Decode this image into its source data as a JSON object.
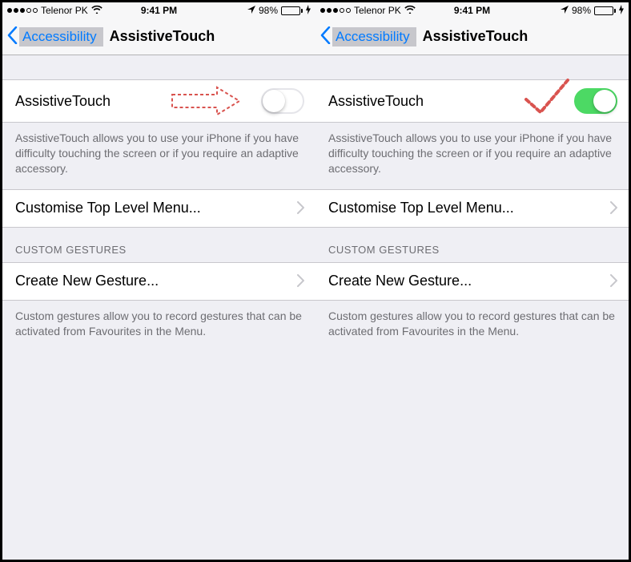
{
  "status_bar": {
    "carrier": "Telenor PK",
    "time": "9:41 PM",
    "battery_pct": "98%",
    "signal_filled": 3,
    "signal_total": 5
  },
  "nav": {
    "back_label": "Accessibility",
    "title": "AssistiveTouch"
  },
  "rows": {
    "toggle_label": "AssistiveTouch",
    "toggle_footer": "AssistiveTouch allows you to use your iPhone if you have difficulty touching the screen or if you require an adaptive accessory.",
    "customise_label": "Customise Top Level Menu...",
    "gestures_header": "CUSTOM GESTURES",
    "create_gesture_label": "Create New Gesture...",
    "gestures_footer": "Custom gestures allow you to record gestures that can be activated from Favourites in the Menu."
  },
  "panes": [
    {
      "toggle_on": false
    },
    {
      "toggle_on": true
    }
  ],
  "colors": {
    "accent": "#007aff",
    "switch_on": "#4cd964",
    "bg": "#efeff4",
    "annot": "#d9534f"
  }
}
